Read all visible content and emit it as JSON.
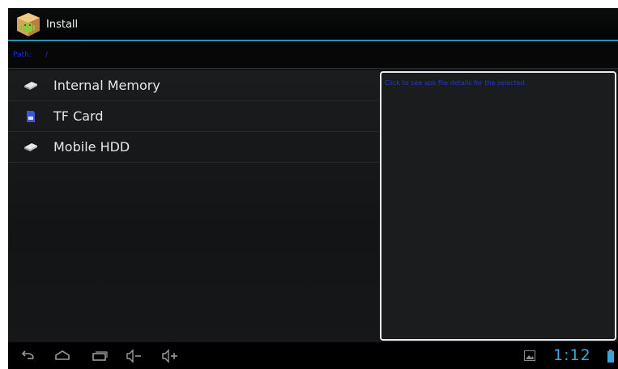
{
  "app": {
    "title": "Install"
  },
  "path_bar": {
    "label": "Path:",
    "value": "/"
  },
  "storage_items": [
    {
      "label": "Internal Memory",
      "icon": "drive-icon"
    },
    {
      "label": "TF Card",
      "icon": "sd-card-icon"
    },
    {
      "label": "Mobile HDD",
      "icon": "drive-icon"
    }
  ],
  "info_panel": {
    "text": "Click to see apk file details for the selected"
  },
  "status": {
    "clock": "1:12"
  },
  "colors": {
    "accent": "#2b8fb8",
    "clock": "#3ca5d6",
    "link_text": "#1b2fd8"
  }
}
